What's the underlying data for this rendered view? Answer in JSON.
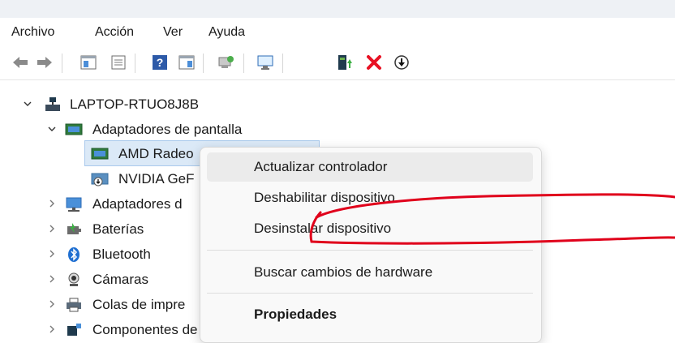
{
  "menubar": {
    "items": [
      {
        "label": "Archivo"
      },
      {
        "label": "Acción"
      },
      {
        "label": "Ver"
      },
      {
        "label": "Ayuda"
      }
    ]
  },
  "toolbar": {
    "icons": [
      "back-arrow-icon",
      "forward-arrow-icon",
      "show-hide-console-tree-icon",
      "properties-icon",
      "help-icon",
      "action-pane-icon",
      "scan-hardware-icon",
      "monitor-icon",
      "update-driver-icon",
      "uninstall-icon",
      "disable-device-icon"
    ]
  },
  "tree": {
    "root": {
      "label": "LAPTOP-RTUO8J8B"
    },
    "items": [
      {
        "label": "Adaptadores de pantalla",
        "expanded": true
      },
      {
        "label": "AMD Radeo",
        "selected": true
      },
      {
        "label": "NVIDIA GeF"
      },
      {
        "label": "Adaptadores d"
      },
      {
        "label": "Baterías"
      },
      {
        "label": "Bluetooth"
      },
      {
        "label": "Cámaras"
      },
      {
        "label": "Colas de impre"
      },
      {
        "label": "Componentes de software"
      }
    ]
  },
  "context_menu": {
    "items": [
      {
        "label": "Actualizar controlador"
      },
      {
        "label": "Deshabilitar dispositivo"
      },
      {
        "label": "Desinstalar dispositivo"
      },
      {
        "label": "Buscar cambios de hardware"
      },
      {
        "label": "Propiedades"
      }
    ]
  },
  "colors": {
    "accent": "#0067c0",
    "selection": "#dbe9f7",
    "annotation": "#e0001b",
    "uninstall_red": "#e81123"
  }
}
